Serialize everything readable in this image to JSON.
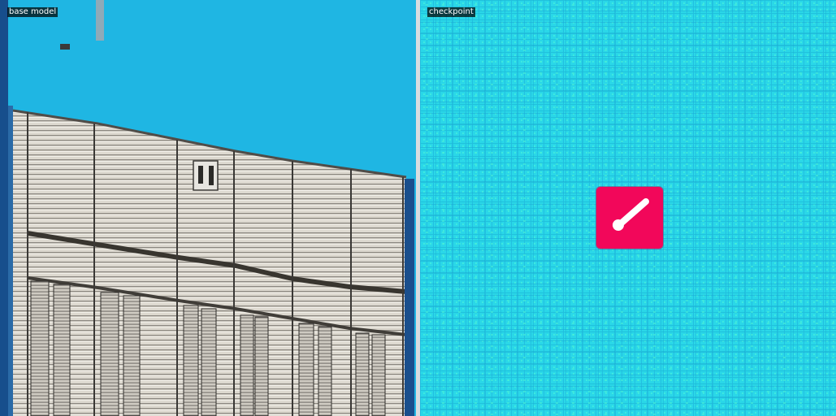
{
  "panels": {
    "left": {
      "label": "base model"
    },
    "right": {
      "label": "checkpoint"
    }
  },
  "colors": {
    "sky": "#1fb6e3",
    "noise_base": "#2ad7e8",
    "icon_tile": "#f2075a",
    "icon_glyph": "#ffffff",
    "facade": "#d8d5cc",
    "frame": "#1b4f86"
  },
  "icons": {
    "right_center": "slash-pen-icon"
  }
}
